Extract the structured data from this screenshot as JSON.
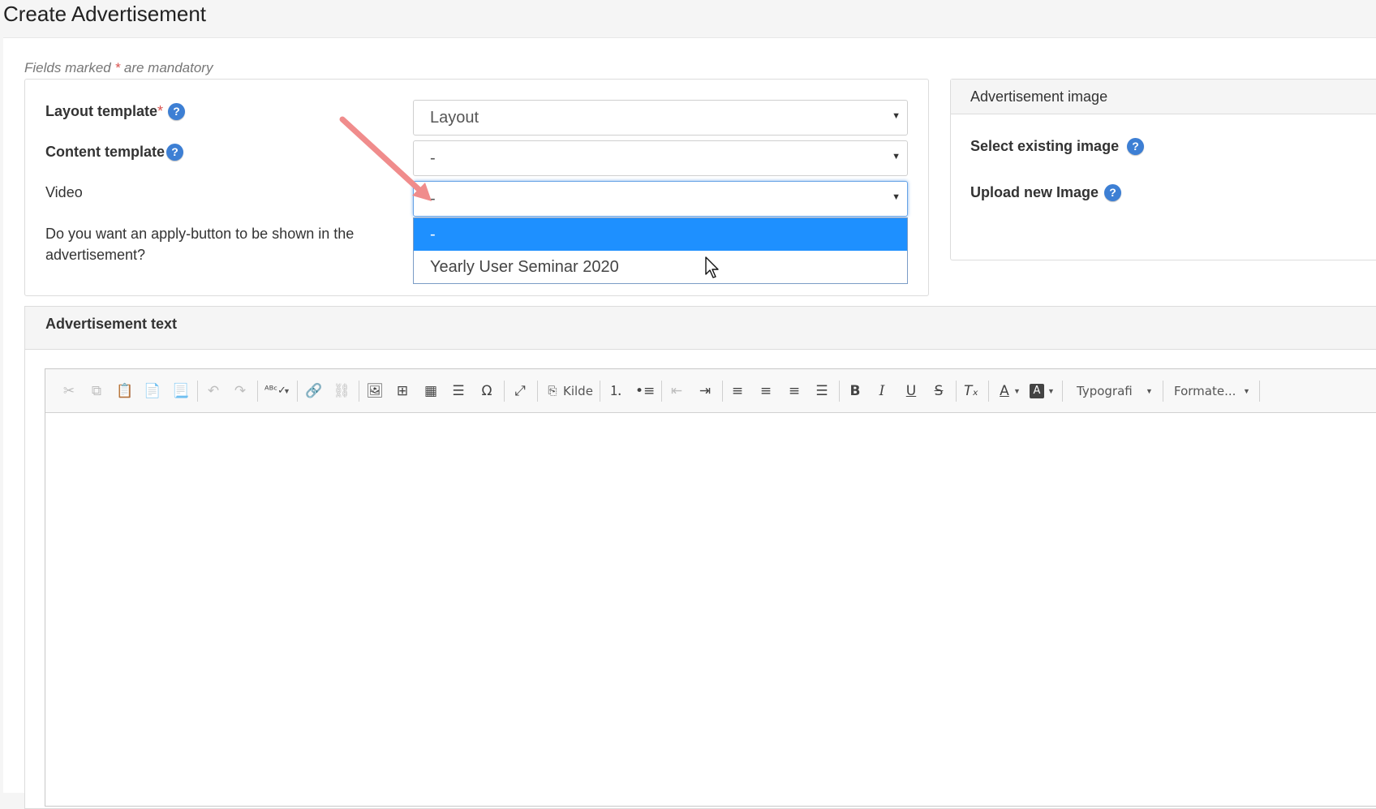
{
  "page": {
    "title": "Create Advertisement"
  },
  "form": {
    "mandatory_prefix": "Fields marked",
    "mandatory_star": "*",
    "mandatory_suffix": "are mandatory",
    "layout_template": {
      "label": "Layout template",
      "required_mark": "*",
      "value": "Layout"
    },
    "content_template": {
      "label": "Content template",
      "value": "-"
    },
    "video": {
      "label": "Video",
      "value": "-",
      "options": [
        "-",
        "Yearly User Seminar 2020"
      ],
      "selected_option": "-"
    },
    "apply_button_question": {
      "line1": "Do you want an apply-button to be shown in the",
      "line2": "advertisement?"
    }
  },
  "image_panel": {
    "header": "Advertisement image",
    "select_existing_label": "Select existing image",
    "upload_new_label": "Upload new Image"
  },
  "text_panel": {
    "header": "Advertisement text",
    "toolbar": {
      "source_label": "Kilde",
      "typography_label": "Typografi",
      "format_label": "Formate...",
      "bold": "B",
      "italic": "I",
      "underline": "U",
      "strike": "S"
    }
  },
  "icons": {
    "help": "question-circle-icon",
    "caret": "triangle-down",
    "annotation": "pink-arrow"
  },
  "colors": {
    "help_icon": "#3d7fd4",
    "selected_option_bg": "#1e90ff",
    "required_mark": "#d9534f",
    "annotation_arrow": "#f08c8c"
  }
}
